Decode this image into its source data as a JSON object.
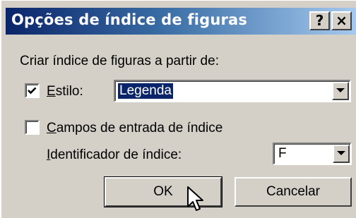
{
  "dialog": {
    "title": "Opções de índice de figuras",
    "help_button": "?",
    "close_button": "×"
  },
  "content": {
    "create_from_label": "Criar índice de figuras a partir de:",
    "style": {
      "checked": true,
      "label_mnemonic": "E",
      "label_rest": "stilo:",
      "value": "Legenda"
    },
    "fields": {
      "checked": false,
      "label_mnemonic": "C",
      "label_rest": "ampos de entrada de índice"
    },
    "identifier": {
      "label_mnemonic": "I",
      "label_rest": "dentificador de índice:",
      "value": "F"
    }
  },
  "buttons": {
    "ok": "OK",
    "cancel": "Cancelar"
  },
  "icons": {
    "checkmark": "checkmark-icon",
    "dropdown": "chevron-down-icon",
    "cursor": "mouse-pointer-icon"
  },
  "colors": {
    "face": "#d4d0c8",
    "title_start": "#0a246a",
    "title_end": "#a6caf0",
    "selection": "#0a246a"
  }
}
